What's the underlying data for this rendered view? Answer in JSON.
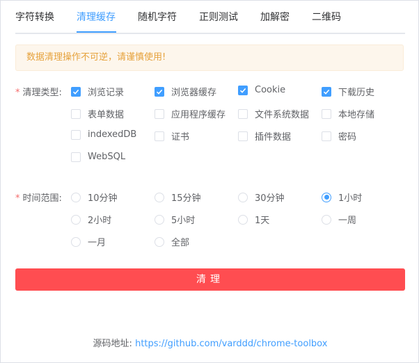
{
  "tabs": [
    "字符转换",
    "清理缓存",
    "随机字符",
    "正则测试",
    "加解密",
    "二维码"
  ],
  "active_tab": 1,
  "alert_text": "数据清理操作不可逆，请谨慎使用!",
  "clean_type": {
    "label": "清理类型:",
    "options": [
      {
        "label": "浏览记录",
        "checked": true
      },
      {
        "label": "浏览器缓存",
        "checked": true
      },
      {
        "label": "Cookie",
        "checked": true
      },
      {
        "label": "下载历史",
        "checked": true
      },
      {
        "label": "表单数据",
        "checked": false
      },
      {
        "label": "应用程序缓存",
        "checked": false
      },
      {
        "label": "文件系统数据",
        "checked": false
      },
      {
        "label": "本地存储",
        "checked": false
      },
      {
        "label": "indexedDB",
        "checked": false
      },
      {
        "label": "证书",
        "checked": false
      },
      {
        "label": "插件数据",
        "checked": false
      },
      {
        "label": "密码",
        "checked": false
      },
      {
        "label": "WebSQL",
        "checked": false
      }
    ]
  },
  "time_range": {
    "label": "时间范围:",
    "options": [
      "10分钟",
      "15分钟",
      "30分钟",
      "1小时",
      "2小时",
      "5小时",
      "1天",
      "一周",
      "一月",
      "全部"
    ],
    "selected": "1小时"
  },
  "clean_button": "清理",
  "footer": {
    "label": "源码地址:",
    "link": "https://github.com/varddd/chrome-toolbox"
  },
  "colors": {
    "accent": "#409eff",
    "danger": "#ff4d51",
    "warning": "#e6a23c"
  }
}
